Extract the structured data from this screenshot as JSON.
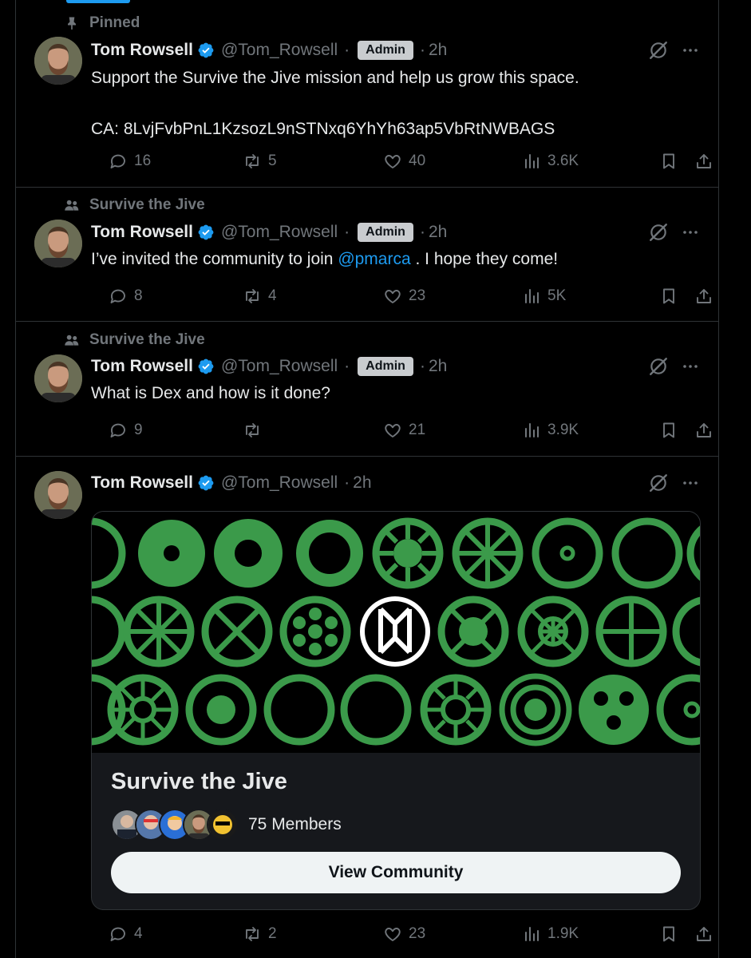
{
  "colors": {
    "accent": "#1d9bf0",
    "muted": "#71767b",
    "text": "#e7e9ea",
    "banner_green": "#3b9a4a",
    "badge_bg": "#c9cccf"
  },
  "icons": {
    "pin": "pin-icon",
    "community": "people-icon",
    "verified": "verified-badge-icon",
    "grok": "grok-icon",
    "more": "more-icon",
    "reply": "reply-icon",
    "repost": "repost-icon",
    "like": "heart-icon",
    "views": "views-icon",
    "bookmark": "bookmark-icon",
    "share": "share-icon"
  },
  "tweets": [
    {
      "context": "Pinned",
      "name": "Tom Rowsell",
      "handle": "@Tom_Rowsell",
      "sep": "·",
      "badge": "Admin",
      "time": "2h",
      "text_line1": "Support the Survive the Jive mission and help us grow this space.",
      "text_line2": "CA: 8LvjFvbPnL1KzsozL9nSTNxq6YhYh63ap5VbRtNWBAGS",
      "replies": "16",
      "reposts": "5",
      "likes": "40",
      "views": "3.6K"
    },
    {
      "context": "Survive the Jive",
      "name": "Tom Rowsell",
      "handle": "@Tom_Rowsell",
      "sep": "·",
      "badge": "Admin",
      "time": "2h",
      "text_before": "I’ve invited the community to join ",
      "mention": "@pmarca",
      "text_after": " . I hope they come!",
      "replies": "8",
      "reposts": "4",
      "likes": "23",
      "views": "5K"
    },
    {
      "context": "Survive the Jive",
      "name": "Tom Rowsell",
      "handle": "@Tom_Rowsell",
      "sep": "·",
      "badge": "Admin",
      "time": "2h",
      "text": "What is Dex and how is it done?",
      "replies": "9",
      "reposts": "",
      "likes": "21",
      "views": "3.9K"
    },
    {
      "name": "Tom Rowsell",
      "handle": "@Tom_Rowsell",
      "sep": "·",
      "time": "2h",
      "card": {
        "community_name": "Survive the Jive",
        "members": "75 Members",
        "button": "View Community"
      },
      "replies": "4",
      "reposts": "2",
      "likes": "23",
      "views": "1.9K"
    }
  ]
}
